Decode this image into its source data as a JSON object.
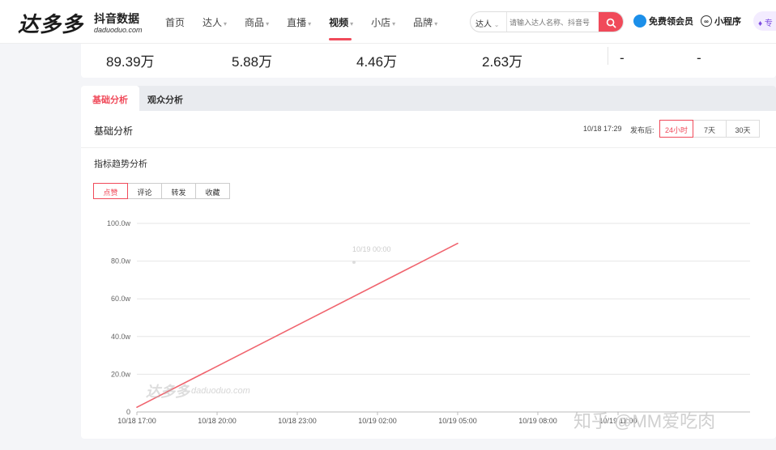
{
  "header": {
    "logo_text": "达多多",
    "logo_subtitle": "抖音数据",
    "logo_url": "daduoduo.com",
    "nav": [
      {
        "label": "首页",
        "caret": false,
        "active": false
      },
      {
        "label": "达人",
        "caret": true,
        "active": false
      },
      {
        "label": "商品",
        "caret": true,
        "active": false
      },
      {
        "label": "直播",
        "caret": true,
        "active": false
      },
      {
        "label": "视频",
        "caret": true,
        "active": true
      },
      {
        "label": "小店",
        "caret": true,
        "active": false
      },
      {
        "label": "品牌",
        "caret": true,
        "active": false
      }
    ],
    "search": {
      "type": "达人",
      "placeholder": "请输入达人名称、抖音号",
      "icon": "search-icon"
    },
    "vip_label": "免费领会员",
    "mini_program_label": "小程序",
    "pro_label": "专"
  },
  "stats": {
    "values": [
      "89.39万",
      "5.88万",
      "4.46万",
      "2.63万",
      "-",
      "-"
    ]
  },
  "tabs": [
    {
      "label": "基础分析",
      "active": true
    },
    {
      "label": "观众分析",
      "active": false
    }
  ],
  "panel": {
    "title": "基础分析",
    "publish_time": "10/18 17:29",
    "publish_label": "发布后:",
    "ranges": [
      {
        "label": "24小时",
        "active": true
      },
      {
        "label": "7天",
        "active": false
      },
      {
        "label": "30天",
        "active": false
      }
    ],
    "trend_title": "指标趋势分析",
    "metrics": [
      {
        "label": "点赞",
        "active": true
      },
      {
        "label": "评论",
        "active": false
      },
      {
        "label": "转发",
        "active": false
      },
      {
        "label": "收藏",
        "active": false
      }
    ]
  },
  "chart_data": {
    "type": "line",
    "title": "",
    "xlabel": "",
    "ylabel": "",
    "x": [
      "10/18 17:00",
      "10/19 05:00"
    ],
    "y_values": [
      2.5,
      89.4
    ],
    "x_ticks": [
      "10/18 17:00",
      "10/18 20:00",
      "10/18 23:00",
      "10/19 02:00",
      "10/19 05:00",
      "10/19 08:00",
      "10/19 11:00"
    ],
    "y_ticks": [
      "0",
      "20.0w",
      "40.0w",
      "60.0w",
      "80.0w",
      "100.0w"
    ],
    "ylim": [
      0,
      100
    ],
    "x_range_hours": [
      0,
      21
    ],
    "grid": true,
    "tooltip_text": "10/19 00:00",
    "line_color": "#f0646e"
  },
  "watermarks": {
    "brand": "达多多",
    "url": "daduoduo.com",
    "credit": "知乎 @MM爱吃肉"
  }
}
